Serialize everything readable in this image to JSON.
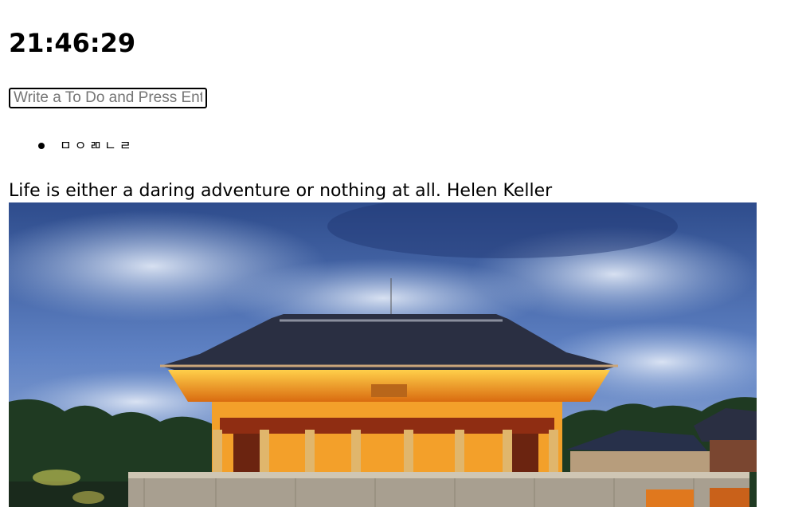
{
  "clock": {
    "time": "21:46:29"
  },
  "todo": {
    "placeholder": "Write a To Do and Press Enter",
    "items": [
      {
        "text": "ㅁㅇㄻㄴㄹ"
      }
    ]
  },
  "quote": {
    "text": "Life is either a daring adventure or nothing at all. Helen Keller"
  },
  "background_image": {
    "icon": "palace-photo",
    "colors": {
      "sky_top": "#2e4c8c",
      "sky_mid": "#5f82c4",
      "cloud": "#c9d6ec",
      "roof": "#2a2f42",
      "lit_gold": "#f0a820",
      "trees": "#1f3a22"
    }
  }
}
